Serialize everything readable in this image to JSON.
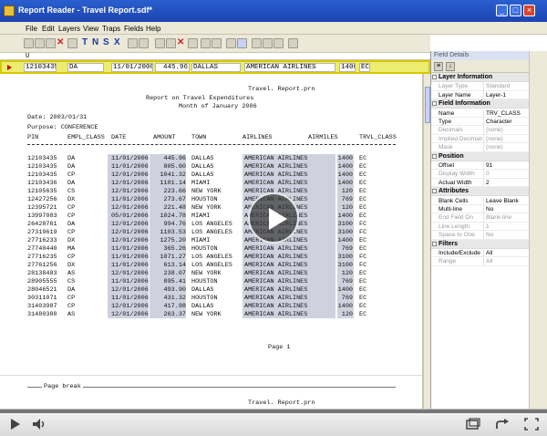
{
  "window": {
    "title": "Report Reader - Travel Report.sdf*"
  },
  "menu": [
    "File",
    "Edit",
    "Layers",
    "View",
    "Traps",
    "Fields",
    "Help"
  ],
  "toolbar": {
    "letters": [
      "T",
      "N",
      "S",
      "X"
    ]
  },
  "cursor_line": "U",
  "field_bar": [
    "12103435",
    "DA",
    "11/01/2006",
    "445.96",
    "DALLAS",
    "AMERICAN AIRLINES",
    "1400",
    "EC"
  ],
  "report": {
    "header_file": "Travel. Report.prn",
    "title": "Report on Travel Expenditures",
    "subtitle": "Month of January 2006",
    "date_line": "Date: 2003/01/31",
    "purpose_line": "Purpose: CONFERENCE",
    "columns": [
      "PIN",
      "EMPL_CLASS",
      "DATE",
      "AMOUNT",
      "TOWN",
      "AIRLINES",
      "AIRMILES",
      "TRVL_CLASS"
    ],
    "rows": [
      [
        "12103435",
        "DA",
        "11/01/2006",
        "445.96",
        "DALLAS",
        "AMERICAN AIRLINES",
        "1400",
        "EC"
      ],
      [
        "12103435",
        "DA",
        "11/01/2006",
        "805.60",
        "DALLAS",
        "AMERICAN AIRLINES",
        "1400",
        "EC"
      ],
      [
        "12103435",
        "CP",
        "12/01/2006",
        "1041.32",
        "DALLAS",
        "AMERICAN AIRLINES",
        "1400",
        "EC"
      ],
      [
        "12103436",
        "DA",
        "12/01/2006",
        "1101.14",
        "MIAMI",
        "AMERICAN AIRLINES",
        "1400",
        "EC"
      ],
      [
        "12105635",
        "CS",
        "12/01/2006",
        "223.66",
        "NEW YORK",
        "AMERICAN AIRLINES",
        "120",
        "EC"
      ],
      [
        "12427256",
        "DX",
        "11/01/2006",
        "273.67",
        "HOUSTON",
        "AMERICAN AIRLINES",
        "769",
        "EC"
      ],
      [
        "12395721",
        "CP",
        "12/01/2006",
        "221.48",
        "NEW YORK",
        "AMERICAN AIRLINES",
        "120",
        "EC"
      ],
      [
        "13997083",
        "CP",
        "05/01/2006",
        "1024.78",
        "MIAMI",
        "AMERICAN AIRLINES",
        "1400",
        "EC"
      ],
      [
        "26428761",
        "DA",
        "12/01/2006",
        "994.76",
        "LOS ANGELES",
        "AMERICAN AIRLINES",
        "3100",
        "FC"
      ],
      [
        "27319619",
        "CP",
        "12/01/2006",
        "1103.53",
        "LOS ANGELES",
        "AMERICAN AIRLINES",
        "3100",
        "FC"
      ],
      [
        "27716233",
        "DX",
        "12/01/2006",
        "1275.20",
        "MIAMI",
        "AMERICAN AIRLINES",
        "1400",
        "EC"
      ],
      [
        "27740440",
        "MA",
        "11/01/2006",
        "365.26",
        "HOUSTON",
        "AMERICAN AIRLINES",
        "769",
        "EC"
      ],
      [
        "27716235",
        "CP",
        "11/01/2006",
        "1071.27",
        "LOS ANGELES",
        "AMERICAN AIRLINES",
        "3100",
        "FC"
      ],
      [
        "27761256",
        "DX",
        "11/01/2006",
        "613.14",
        "LOS ANGELES",
        "AMERICAN AIRLINES",
        "3100",
        "FC"
      ],
      [
        "28138483",
        "AS",
        "12/01/2006",
        "238.07",
        "NEW YORK",
        "AMERICAN AIRLINES",
        "120",
        "EC"
      ],
      [
        "28905555",
        "CS",
        "11/01/2006",
        "895.41",
        "HOUSTON",
        "AMERICAN AIRLINES",
        "769",
        "EC"
      ],
      [
        "28046521",
        "DA",
        "12/01/2006",
        "493.90",
        "DALLAS",
        "AMERICAN AIRLINES",
        "1400",
        "EC"
      ],
      [
        "30311071",
        "CP",
        "11/01/2006",
        "431.32",
        "HOUSTON",
        "AMERICAN AIRLINES",
        "769",
        "EC"
      ],
      [
        "31403987",
        "CP",
        "12/01/2006",
        "417.98",
        "DALLAS",
        "AMERICAN AIRLINES",
        "1400",
        "EC"
      ],
      [
        "31480380",
        "AS",
        "12/01/2006",
        "263.37",
        "NEW YORK",
        "AMERICAN AIRLINES",
        "120",
        "EC"
      ]
    ],
    "page_label": "Page 1",
    "page_break": "Page break",
    "footer_file": "Travel. Report.prn"
  },
  "panel": {
    "header": "Field Details",
    "sections": [
      {
        "title": "Layer Information",
        "rows": [
          {
            "k": "Layer Type",
            "v": "Standard",
            "dim": true
          },
          {
            "k": "Layer Name",
            "v": "Layer-1",
            "dim": false
          }
        ]
      },
      {
        "title": "Field Information",
        "rows": [
          {
            "k": "Name",
            "v": "TRV_CLASS",
            "dim": false
          },
          {
            "k": "Type",
            "v": "Character",
            "dim": false
          },
          {
            "k": "Decimals",
            "v": "(none)",
            "dim": true
          },
          {
            "k": "Implied Decimals",
            "v": "(none)",
            "dim": true
          },
          {
            "k": "Mask",
            "v": "(none)",
            "dim": true
          }
        ]
      },
      {
        "title": "Position",
        "rows": [
          {
            "k": "Offset",
            "v": "91",
            "dim": false
          },
          {
            "k": "Display Width",
            "v": "0",
            "dim": true
          },
          {
            "k": "Actual Width",
            "v": "2",
            "dim": false
          }
        ]
      },
      {
        "title": "Attributes",
        "rows": [
          {
            "k": "Blank Cells",
            "v": "Leave Blank",
            "dim": false
          },
          {
            "k": "Multi-line",
            "v": "No",
            "dim": false
          },
          {
            "k": "End Field On",
            "v": "Blank line",
            "dim": true
          },
          {
            "k": "Line Length",
            "v": "1",
            "dim": true
          },
          {
            "k": "Space to One",
            "v": "No",
            "dim": true
          }
        ]
      },
      {
        "title": "Filters",
        "rows": [
          {
            "k": "Include/Exclude",
            "v": "All",
            "dim": false
          },
          {
            "k": "Range",
            "v": "All",
            "dim": true
          }
        ]
      }
    ]
  },
  "player": {
    "progress": 0.0
  },
  "colors": {
    "accent": "#cc0000",
    "title_bar": "#2a5fcf",
    "highlight": "#ecec70"
  }
}
